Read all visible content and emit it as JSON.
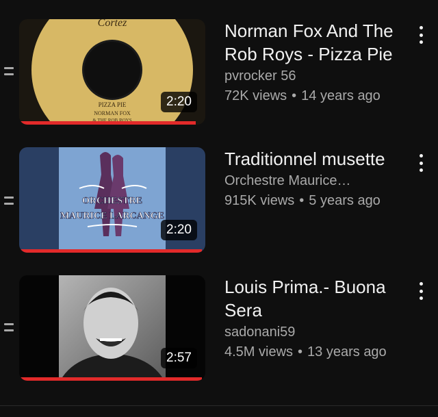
{
  "playlist": {
    "items": [
      {
        "title": "Norman Fox And The Rob Roys - Pizza Pie",
        "channel": "pvrocker 56",
        "views": "72K views",
        "age": "14 years ago",
        "duration": "2:20",
        "watched_fraction": 0.95,
        "thumb_text": {
          "brand": "Cortez",
          "song": "PIZZA PIE",
          "artist1": "NORMAN FOX",
          "artist2": "& THE ROB ROYS"
        }
      },
      {
        "title": "Traditionnel musette",
        "channel": "Orchestre Maurice…",
        "views": "915K views",
        "age": "5 years ago",
        "duration": "2:20",
        "watched_fraction": 0.98,
        "thumb_text": {
          "line1": "ORCHESTRE",
          "line2": "MAURICE LARCANGE"
        }
      },
      {
        "title": "Louis Prima.- Buona Sera",
        "channel": "sadonani59",
        "views": "4.5M views",
        "age": "13 years ago",
        "duration": "2:57",
        "watched_fraction": 0.98
      }
    ],
    "separator": "•"
  },
  "colors": {
    "progress": "#e22a2a",
    "background": "#0f0f0f",
    "secondary_text": "#aaaaaa"
  }
}
